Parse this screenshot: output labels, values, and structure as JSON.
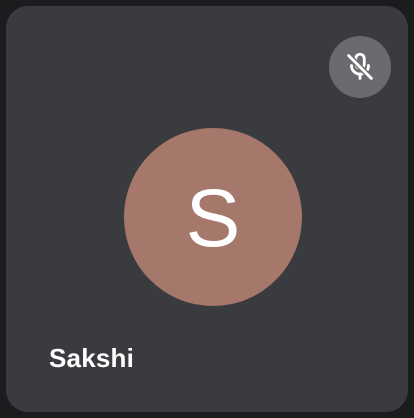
{
  "participant": {
    "name": "Sakshi",
    "initial": "S",
    "avatar_color": "#a5786b",
    "mic_state": "muted",
    "mic_icon": "mic-off-icon"
  },
  "tile": {
    "background": "#3a3b3e",
    "badge_background": "#6a6b6f"
  }
}
